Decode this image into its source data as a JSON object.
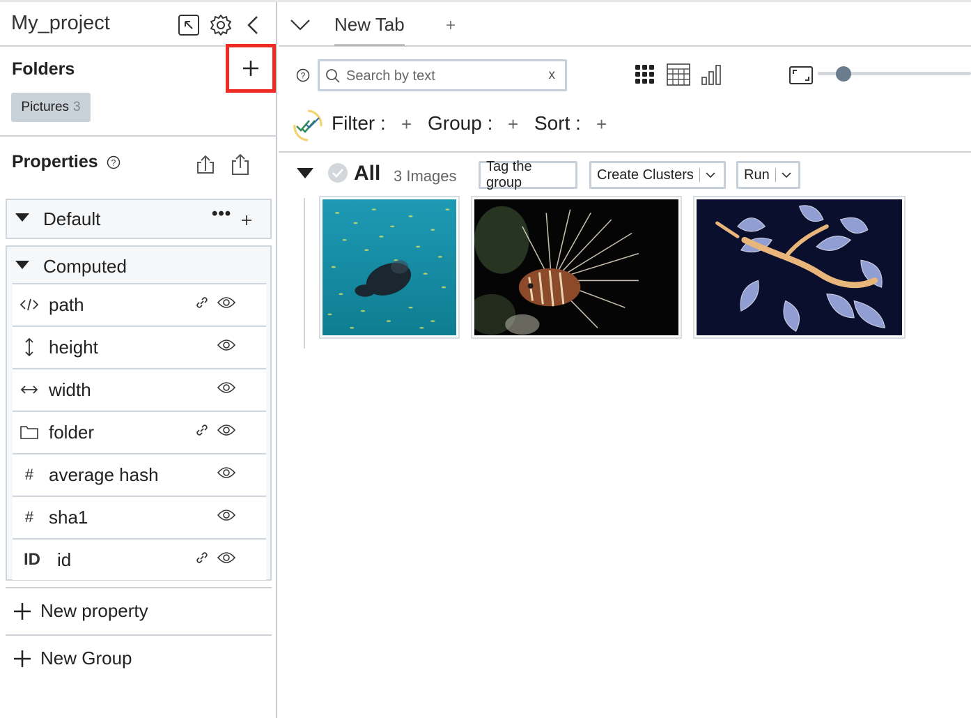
{
  "project": {
    "title": "My_project"
  },
  "folders": {
    "title": "Folders",
    "items": [
      {
        "label": "Pictures",
        "count": "3"
      }
    ]
  },
  "properties": {
    "title": "Properties",
    "groups": [
      {
        "label": "Default",
        "rows": []
      },
      {
        "label": "Computed",
        "rows": [
          {
            "icon": "code-icon",
            "label": "path",
            "linked": true
          },
          {
            "icon": "vertical-arrows-icon",
            "label": "height",
            "linked": false
          },
          {
            "icon": "horizontal-arrows-icon",
            "label": "width",
            "linked": false
          },
          {
            "icon": "folder-icon",
            "label": "folder",
            "linked": true
          },
          {
            "icon": "#",
            "label": "average hash",
            "linked": false
          },
          {
            "icon": "#",
            "label": "sha1",
            "linked": false
          },
          {
            "icon": "ID",
            "label": "id",
            "linked": true
          }
        ]
      }
    ],
    "new_property": "New property",
    "new_group": "New Group"
  },
  "tabs": [
    {
      "label": "New Tab",
      "active": true
    }
  ],
  "toolbar": {
    "search_placeholder": "Search by text",
    "clear": "x",
    "zoom_level": 0.17
  },
  "filters": {
    "filter": "Filter :",
    "group": "Group :",
    "sort": "Sort :"
  },
  "group_header": {
    "label": "All",
    "count": "3 Images",
    "tag_button": "Tag the group",
    "clusters_button": "Create Clusters",
    "run_button": "Run"
  },
  "images": [
    {
      "name": "fish-school-thumbnail"
    },
    {
      "name": "lionfish-thumbnail"
    },
    {
      "name": "leafy-seadragon-thumbnail"
    }
  ],
  "colors": {
    "highlight": "#ee2b22",
    "chip": "#c9d1d9",
    "accent": "#6b7c8e"
  }
}
